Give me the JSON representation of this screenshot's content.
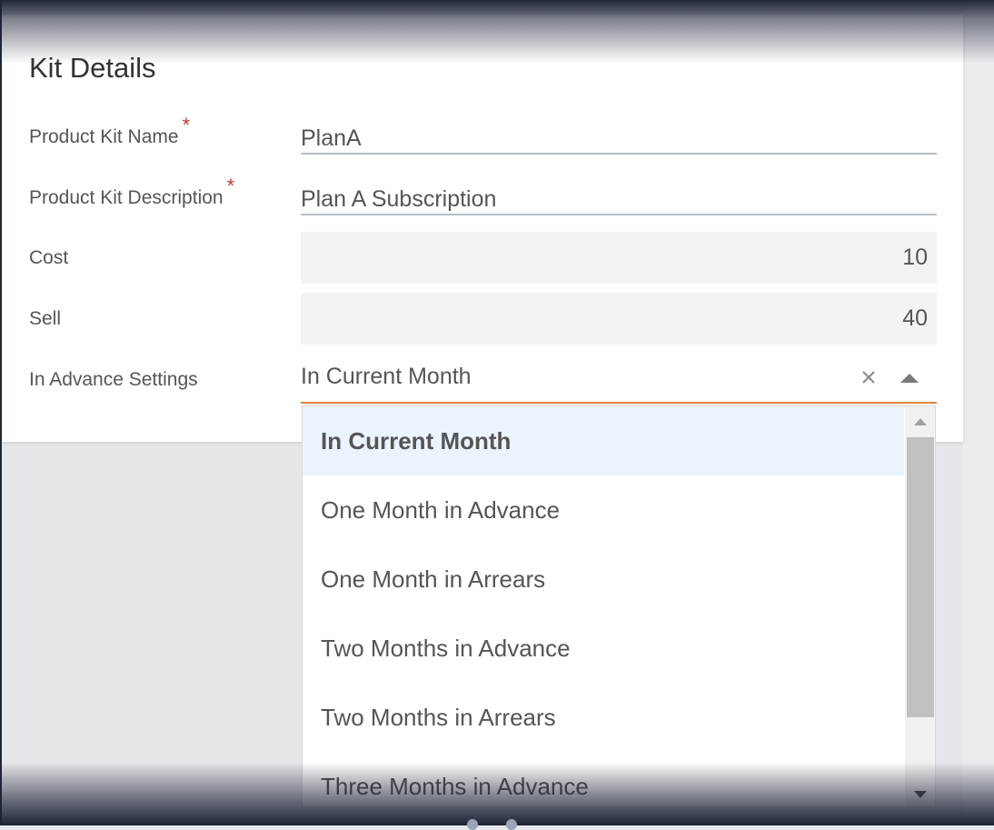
{
  "page_title": "Kit Details",
  "form": {
    "product_kit_name": {
      "label": "Product Kit Name",
      "required_marker": "*",
      "value": "PlanA"
    },
    "product_kit_description": {
      "label": "Product Kit Description",
      "required_marker": "*",
      "value": "Plan A Subscription"
    },
    "cost": {
      "label": "Cost",
      "value": "10"
    },
    "sell": {
      "label": "Sell",
      "value": "40"
    },
    "in_advance_settings": {
      "label": "In Advance Settings",
      "value": "In Current Month",
      "clear_icon": "close-icon",
      "toggle_icon": "caret-up-icon"
    }
  },
  "dropdown": {
    "options": [
      "In Current Month",
      "One Month in Advance",
      "One Month in Arrears",
      "Two Months in Advance",
      "Two Months in Arrears",
      "Three Months in Advance"
    ],
    "selected": "In Current Month"
  },
  "colors": {
    "accent_underline": "#e0853d",
    "required": "#c0392b",
    "selected_option_bg": "#ebf4fd"
  }
}
